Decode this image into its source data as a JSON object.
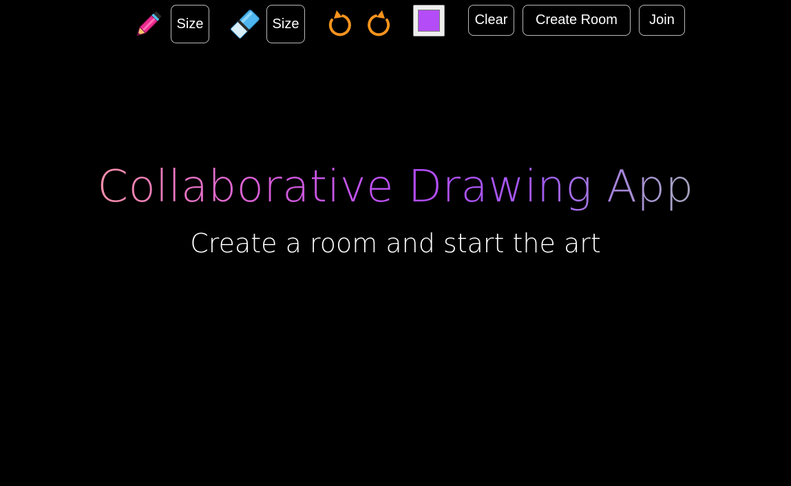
{
  "toolbar": {
    "pen_size_label": "Size",
    "eraser_size_label": "Size",
    "clear_label": "Clear",
    "create_room_label": "Create Room",
    "join_label": "Join",
    "icons": {
      "pencil": "pencil-icon",
      "eraser": "eraser-icon",
      "undo": "undo-icon",
      "redo": "redo-icon"
    },
    "selected_color": "#b44cf7"
  },
  "hero": {
    "title": "Collaborative Drawing App",
    "subtitle": "Create a room and start the art"
  },
  "colors": {
    "background": "#000000",
    "pencil": "#ec2b8f",
    "eraser": "#5cc4f2",
    "undo_redo": "#f7941d",
    "button_border": "#b9b9b9",
    "title_gradient": [
      "#f78fa7",
      "#d65cd6",
      "#b44cf7",
      "#a259f0",
      "#9d9d9d"
    ]
  }
}
